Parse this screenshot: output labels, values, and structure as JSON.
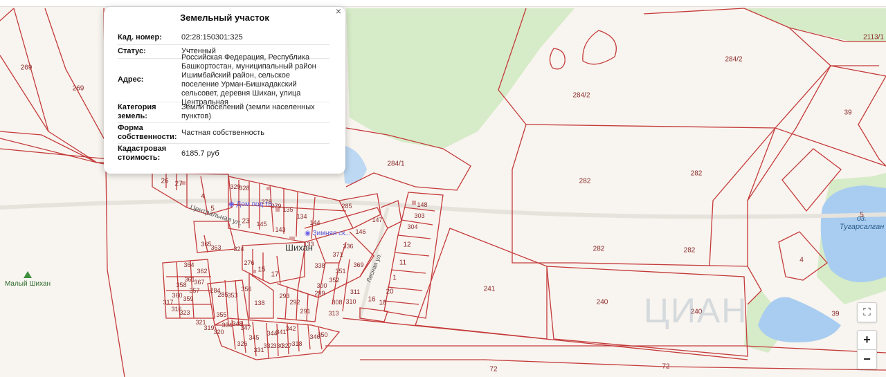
{
  "popup": {
    "title": "Земельный участок",
    "close_glyph": "×",
    "rows": [
      {
        "key": "Кад. номер:",
        "value": "02:28:150301:325"
      },
      {
        "key": "Статус:",
        "value": "Учтенный"
      },
      {
        "key": "Адрес:",
        "value": "Российская Федерация, Республика Башкортостан, муниципальный район Ишимбайский район, сельское поселение Урман-Бишкадакский сельсовет, деревня Шихан, улица Центральная"
      },
      {
        "key": "Категория земель:",
        "value": "Земли поселений (земли населенных пунктов)"
      },
      {
        "key": "Форма собственности:",
        "value": "Частная собственность"
      },
      {
        "key": "Кадастровая стоимость:",
        "value": "6185.7 руб"
      }
    ]
  },
  "map": {
    "place_name": "Шихан",
    "mountain": "Малый Шихан",
    "lake": "оз. Тугарсалган",
    "street_central": "Центральная ул.",
    "street_lesnaya": "Лесная ул.",
    "poi_house": "Дом под то...",
    "poi_winter": "Зимняя ск...",
    "watermark": "ЦИАН",
    "parcels": [
      {
        "t": "269"
      },
      {
        "t": "269"
      },
      {
        "t": "284/2"
      },
      {
        "t": "284/2"
      },
      {
        "t": "2113/1"
      },
      {
        "t": "39"
      },
      {
        "t": "284/1"
      },
      {
        "t": "282"
      },
      {
        "t": "282"
      },
      {
        "t": "282"
      },
      {
        "t": "282"
      },
      {
        "t": "5"
      },
      {
        "t": "4"
      },
      {
        "t": "241"
      },
      {
        "t": "240"
      },
      {
        "t": "240"
      },
      {
        "t": "39"
      },
      {
        "t": "72"
      },
      {
        "t": "72"
      },
      {
        "t": "285"
      },
      {
        "t": "148"
      },
      {
        "t": "303"
      },
      {
        "t": "304"
      },
      {
        "t": "12"
      },
      {
        "t": "11"
      },
      {
        "t": "1"
      },
      {
        "t": "20"
      },
      {
        "t": "18"
      },
      {
        "t": "16"
      },
      {
        "t": "147"
      },
      {
        "t": "146"
      },
      {
        "t": "336"
      },
      {
        "t": "369"
      },
      {
        "t": "371"
      },
      {
        "t": "338"
      },
      {
        "t": "351"
      },
      {
        "t": "352"
      },
      {
        "t": "300"
      },
      {
        "t": "299"
      },
      {
        "t": "293"
      },
      {
        "t": "292"
      },
      {
        "t": "291"
      },
      {
        "t": "308"
      },
      {
        "t": "313"
      },
      {
        "t": "310"
      },
      {
        "t": "311"
      },
      {
        "t": "135"
      },
      {
        "t": "134"
      },
      {
        "t": "144"
      },
      {
        "t": "143"
      },
      {
        "t": "279"
      },
      {
        "t": "278"
      },
      {
        "t": "145"
      },
      {
        "t": "23"
      },
      {
        "t": "329"
      },
      {
        "t": "328"
      },
      {
        "t": "26"
      },
      {
        "t": "27"
      },
      {
        "t": "4"
      },
      {
        "t": "5"
      },
      {
        "t": "365"
      },
      {
        "t": "363"
      },
      {
        "t": "324"
      },
      {
        "t": "276"
      },
      {
        "t": "15"
      },
      {
        "t": "17"
      },
      {
        "t": "364"
      },
      {
        "t": "362"
      },
      {
        "t": "361"
      },
      {
        "t": "367"
      },
      {
        "t": "358"
      },
      {
        "t": "357"
      },
      {
        "t": "360"
      },
      {
        "t": "359"
      },
      {
        "t": "317"
      },
      {
        "t": "316"
      },
      {
        "t": "323"
      },
      {
        "t": "284"
      },
      {
        "t": "285"
      },
      {
        "t": "353"
      },
      {
        "t": "356"
      },
      {
        "t": "138"
      },
      {
        "t": "355"
      },
      {
        "t": "321"
      },
      {
        "t": "319"
      },
      {
        "t": "320"
      },
      {
        "t": "334"
      },
      {
        "t": "348"
      },
      {
        "t": "347"
      },
      {
        "t": "326"
      },
      {
        "t": "345"
      },
      {
        "t": "331"
      },
      {
        "t": "332"
      },
      {
        "t": "344"
      },
      {
        "t": "330"
      },
      {
        "t": "341"
      },
      {
        "t": "327"
      },
      {
        "t": "342"
      },
      {
        "t": "318"
      },
      {
        "t": "340"
      },
      {
        "t": "350"
      },
      {
        "t": "133"
      }
    ]
  },
  "controls": {
    "fullscreen_glyph": "⛶",
    "zoom_in": "+",
    "zoom_out": "−"
  }
}
